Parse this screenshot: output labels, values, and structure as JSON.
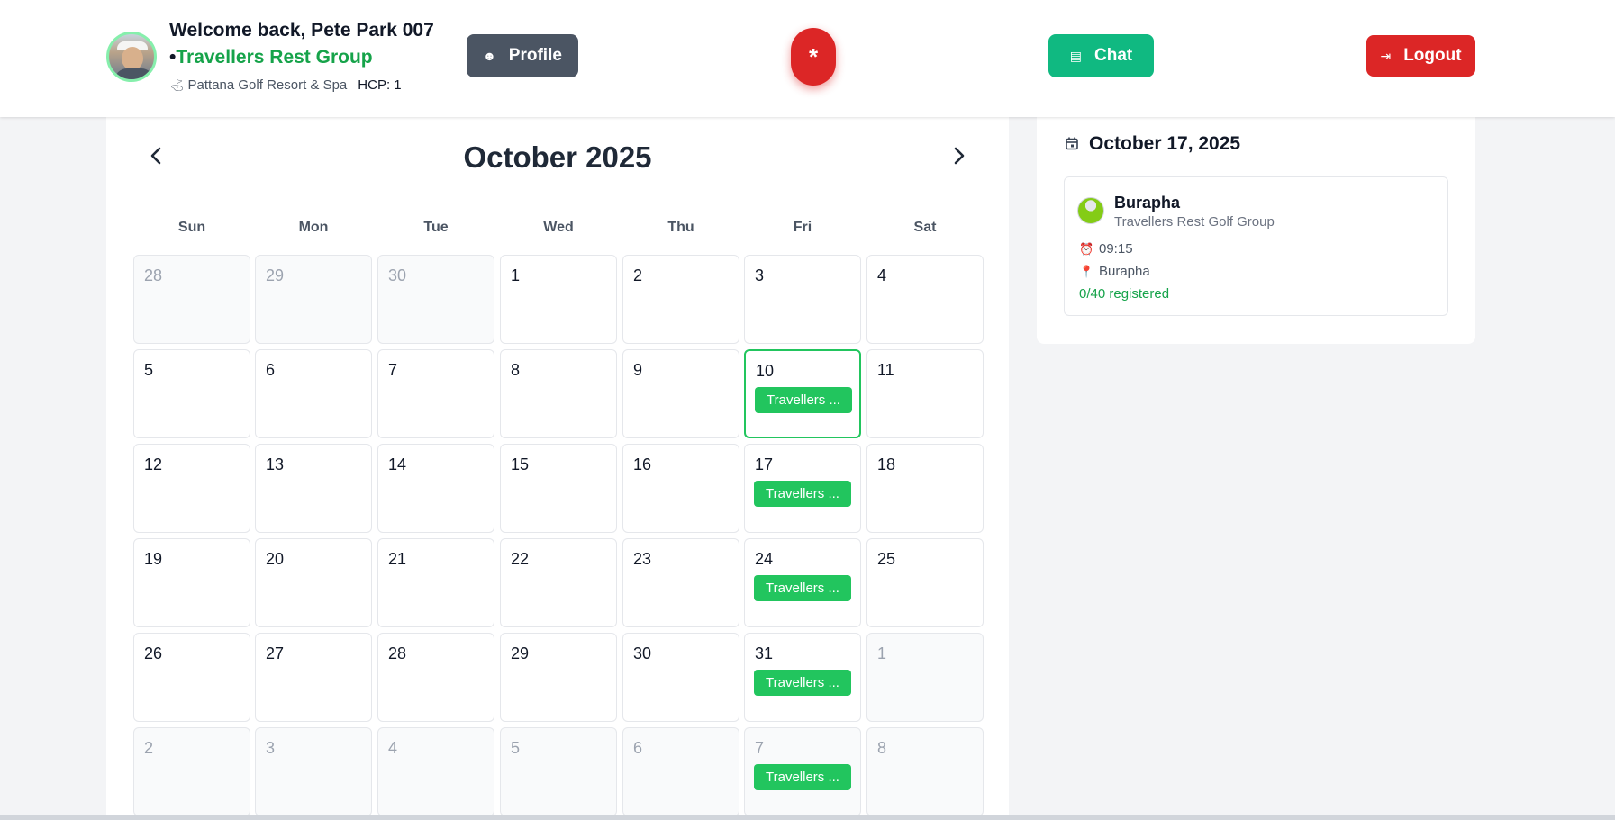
{
  "header": {
    "welcome": "Welcome back, Pete Park 007",
    "bullet": "•",
    "group": "Travellers Rest Group",
    "course_icon": "golf-flag-icon",
    "course": "Pattana Golf Resort & Spa",
    "hcp": "HCP: 1",
    "profile_label": "Profile",
    "profile_icon": "user-icon",
    "sos_label": "*",
    "chat_label": "Chat",
    "chat_icon": "message-icon",
    "logout_label": "Logout",
    "logout_icon": "logout-icon"
  },
  "calendar": {
    "title": "October 2025",
    "prev_icon": "chevron-left-icon",
    "next_icon": "chevron-right-icon",
    "days_of_week": [
      "Sun",
      "Mon",
      "Tue",
      "Wed",
      "Thu",
      "Fri",
      "Sat"
    ],
    "event_label": "Travellers ...",
    "weeks": [
      [
        {
          "d": "28",
          "other": true
        },
        {
          "d": "29",
          "other": true
        },
        {
          "d": "30",
          "other": true
        },
        {
          "d": "1"
        },
        {
          "d": "2"
        },
        {
          "d": "3"
        },
        {
          "d": "4"
        }
      ],
      [
        {
          "d": "5"
        },
        {
          "d": "6"
        },
        {
          "d": "7"
        },
        {
          "d": "8"
        },
        {
          "d": "9"
        },
        {
          "d": "10",
          "event": true,
          "selected": true
        },
        {
          "d": "11"
        }
      ],
      [
        {
          "d": "12"
        },
        {
          "d": "13"
        },
        {
          "d": "14"
        },
        {
          "d": "15"
        },
        {
          "d": "16"
        },
        {
          "d": "17",
          "event": true
        },
        {
          "d": "18"
        }
      ],
      [
        {
          "d": "19"
        },
        {
          "d": "20"
        },
        {
          "d": "21"
        },
        {
          "d": "22"
        },
        {
          "d": "23"
        },
        {
          "d": "24",
          "event": true
        },
        {
          "d": "25"
        }
      ],
      [
        {
          "d": "26"
        },
        {
          "d": "27"
        },
        {
          "d": "28"
        },
        {
          "d": "29"
        },
        {
          "d": "30"
        },
        {
          "d": "31",
          "event": true
        },
        {
          "d": "1",
          "other": true
        }
      ],
      [
        {
          "d": "2",
          "other": true
        },
        {
          "d": "3",
          "other": true
        },
        {
          "d": "4",
          "other": true
        },
        {
          "d": "5",
          "other": true
        },
        {
          "d": "6",
          "other": true
        },
        {
          "d": "7",
          "other": true,
          "event": true
        },
        {
          "d": "8",
          "other": true
        }
      ]
    ]
  },
  "day_panel": {
    "date_title": "October 17, 2025",
    "calendar_icon": "calendar-icon",
    "event": {
      "course": "Burapha",
      "group": "Travellers Rest Golf Group",
      "time": "09:15",
      "time_icon": "alarm-clock-icon",
      "location": "Burapha",
      "location_icon": "map-pin-icon",
      "registered": "0/40 registered"
    }
  },
  "colors": {
    "accent_green": "#22c55e",
    "chat_green": "#10b981",
    "logout_red": "#dc2626",
    "profile_gray": "#4b5563"
  }
}
